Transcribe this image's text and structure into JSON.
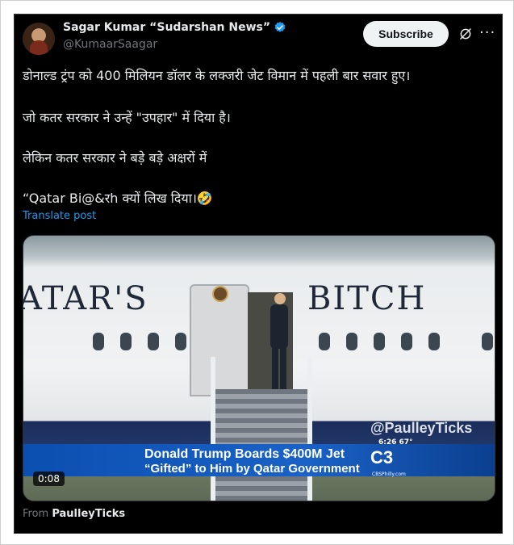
{
  "author": {
    "display_name": "Sagar Kumar “Sudarshan News”",
    "handle": "@KumaarSaagar",
    "verified": true
  },
  "header": {
    "subscribe_label": "Subscribe",
    "grok_icon": "grok-icon",
    "more_icon": "···"
  },
  "post": {
    "lines": [
      "डोनाल्ड ट्रंप को 400 मिलियन डॉलर के लक्जरी जेट विमान में पहली बार सवार हुए।",
      "जो कतर सरकार ने उन्हें \"उपहार\" में दिया है।",
      "लेकिन कतर सरकार ने बड़े बड़े अक्षरों में",
      "“Qatar Bi@&रh क्यों लिख दिया।🤣"
    ],
    "translate_label": "Translate post"
  },
  "video": {
    "plane_text_left": "ATAR'S",
    "plane_text_right": "BITCH",
    "lower_third_line1": "Donald Trump Boards $400M Jet",
    "lower_third_line2": "“Gifted” to Him by Qatar Government",
    "watermark": "@PaulleyTicks",
    "time_temp": "6:26  67°",
    "station_logo": "C3",
    "station_url": "CBSPhilly.com",
    "duration": "0:08"
  },
  "source": {
    "prefix": "From ",
    "name": "PaulleyTicks"
  },
  "colors": {
    "background": "#000000",
    "text": "#e7e9ea",
    "muted": "#71767b",
    "link": "#1d9bf0",
    "verified": "#1d9bf0"
  }
}
